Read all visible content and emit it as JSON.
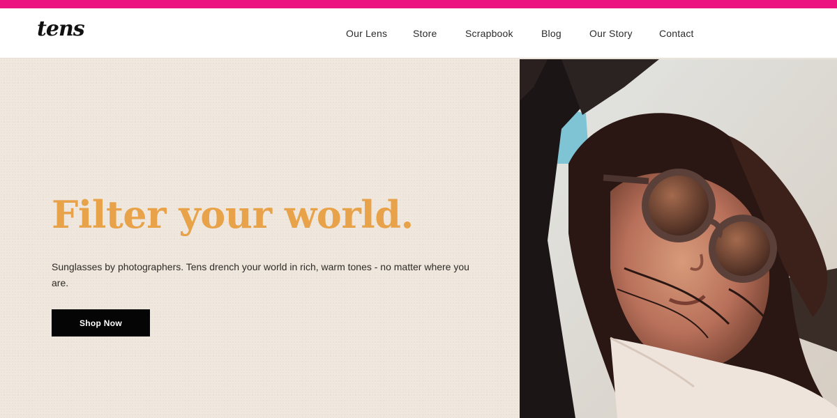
{
  "brand": {
    "logo_text": "tens",
    "accent_color": "#ec1380"
  },
  "nav": {
    "items": [
      {
        "label": "Our Lens"
      },
      {
        "label": "Store"
      },
      {
        "label": "Scrapbook"
      },
      {
        "label": "Blog"
      },
      {
        "label": "Our Story"
      },
      {
        "label": "Contact"
      }
    ]
  },
  "hero": {
    "headline": "Filter your world.",
    "headline_color": "#e8a249",
    "subcopy": "Sunglasses by photographers. Tens drench your world in rich, warm tones - no matter where you are.",
    "cta_label": "Shop Now",
    "image_subject": "woman-with-sunglasses-in-car-window-photo"
  }
}
